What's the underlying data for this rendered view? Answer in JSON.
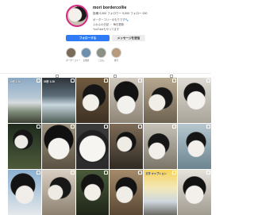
{
  "profile": {
    "username": "mori bordercollie",
    "stats_text": "投稿 0,000  フォロワー 0,000  フォロー 000",
    "bio_lines": [
      "ボーダーコリーのもりです🐾",
      "ふわふわ日記 ・ 毎日更新",
      "YouTubeもやってます"
    ],
    "follow_label": "フォローする",
    "message_label": "メッセージを送信"
  },
  "highlights": [
    {
      "label": "ボーダーコリー",
      "color": "#7a6a58"
    },
    {
      "label": "お散歩",
      "color": "#6d8fb0"
    },
    {
      "label": "ごはん",
      "color": "#8b8f86"
    },
    {
      "label": "旅行",
      "color": "#b89a7c"
    }
  ],
  "tabs": [
    {
      "name": "posts-tab"
    },
    {
      "name": "reels-tab"
    },
    {
      "name": "tagged-tab"
    }
  ],
  "grid_posts": [
    {
      "caption": "30秒 1:28",
      "bg": "linear-gradient(#8aa9c4 0%, #b9c9d6 45%, #d8dde0 55%, #7f8c7a 75%, #3b3f35 100%)",
      "dark": false
    },
    {
      "caption": "30秒 1:28",
      "bg": "linear-gradient(#2c3238 0%, #5c6e7a 40%, #c9d6de 60%, #4b5b53 100%)",
      "dark": false
    },
    {
      "caption": "",
      "bg": "radial-gradient(circle at 45% 55%, #f2efe9 0 10px, transparent 11px), radial-gradient(circle at 55% 40%, #151515 0 14px, transparent 15px), linear-gradient(#6f5a3f, #3e3124)",
      "dark": false
    },
    {
      "caption": "",
      "bg": "radial-gradient(circle at 50% 60%, #f3f1ed 0 11px, transparent 12px), radial-gradient(circle at 50% 35%, #121212 0 15px, transparent 16px), linear-gradient(#cfc8bd, #8f8577)",
      "dark": false
    },
    {
      "caption": "",
      "bg": "radial-gradient(circle at 40% 55%, #f1eee8 0 10px, transparent 11px), radial-gradient(circle at 55% 45%, #161616 0 13px, transparent 14px), linear-gradient(#b7a890, #6d6250)",
      "dark": false
    },
    {
      "caption": "",
      "bg": "radial-gradient(circle at 55% 50%, #f4f2ee 0 11px, transparent 12px), radial-gradient(circle at 50% 35%, #141414 0 13px, transparent 14px), linear-gradient(#dcdad3, #a9a498)",
      "dark": false
    },
    {
      "caption": "",
      "bg": "radial-gradient(circle at 40% 40%, #eceae5 0 8px, transparent 9px), radial-gradient(circle at 45% 35%, #151515 0 12px, transparent 13px), linear-gradient(#1f2a1d, #4d5b3a)",
      "dark": false
    },
    {
      "caption": "",
      "bg": "radial-gradient(circle at 50% 55%, #f5f3ef 0 13px, transparent 14px), radial-gradient(circle at 50% 35%, #101010 0 18px, transparent 19px), linear-gradient(#9d927f, #5a5143)",
      "dark": false
    },
    {
      "caption": "",
      "bg": "radial-gradient(circle at 50% 55%, #f7f5f2 0 16px, transparent 17px), radial-gradient(circle at 50% 50%, #202020 0 20px, transparent 21px), linear-gradient(#3b3b3b, #2a2a2a)",
      "dark": false
    },
    {
      "caption": "",
      "bg": "radial-gradient(circle at 45% 45%, #efece6 0 9px, transparent 10px), radial-gradient(circle at 50% 40%, #121212 0 12px, transparent 13px), linear-gradient(#7d6b56, #2f2a24)",
      "dark": false
    },
    {
      "caption": "",
      "bg": "radial-gradient(circle at 40% 60%, #f2efea 0 10px, transparent 11px), radial-gradient(circle at 45% 45%, #161616 0 13px, transparent 14px), linear-gradient(#c7c2b8, #7a7468)",
      "dark": false
    },
    {
      "caption": "",
      "bg": "radial-gradient(circle at 55% 55%, #f3f0eb 0 10px, transparent 11px), radial-gradient(circle at 55% 40%, #151515 0 12px, transparent 13px), linear-gradient(#b6c7cf, #6c8590)",
      "dark": false
    },
    {
      "caption": "",
      "bg": "radial-gradient(circle at 50% 55%, #f1eee9 0 11px, transparent 12px), radial-gradient(circle at 45% 35%, #131313 0 15px, transparent 16px), linear-gradient(#8cb0d0, #e4e8ea)",
      "dark": false
    },
    {
      "caption": "",
      "bg": "radial-gradient(circle at 40% 50%, #eeebe5 0 9px, transparent 10px), radial-gradient(circle at 55% 40%, #171717 0 13px, transparent 14px), linear-gradient(#d8cfc2, #8d8171)",
      "dark": false
    },
    {
      "caption": "",
      "bg": "radial-gradient(circle at 50% 50%, #f2efe9 0 10px, transparent 11px), radial-gradient(circle at 50% 35%, #141414 0 14px, transparent 15px), linear-gradient(#4a5a3a, #1f2619)",
      "dark": false
    },
    {
      "caption": "",
      "bg": "radial-gradient(circle at 45% 55%, #f0ede7 0 10px, transparent 11px), radial-gradient(circle at 50% 40%, #131313 0 13px, transparent 14px), linear-gradient(#a58a6a, #5a4835)",
      "dark": false
    },
    {
      "caption": "文字 キャプション",
      "bg": "linear-gradient(#f7d25a 0%, #f2e8b8 40%, #cfd7df 70%, #6b6a64 100%)",
      "dark": true
    },
    {
      "caption": "",
      "bg": "radial-gradient(circle at 50% 55%, #f3f0eb 0 11px, transparent 12px), radial-gradient(circle at 50% 40%, #121212 0 14px, transparent 15px), linear-gradient(#e5e2dc, #a29c90)",
      "dark": false
    }
  ]
}
